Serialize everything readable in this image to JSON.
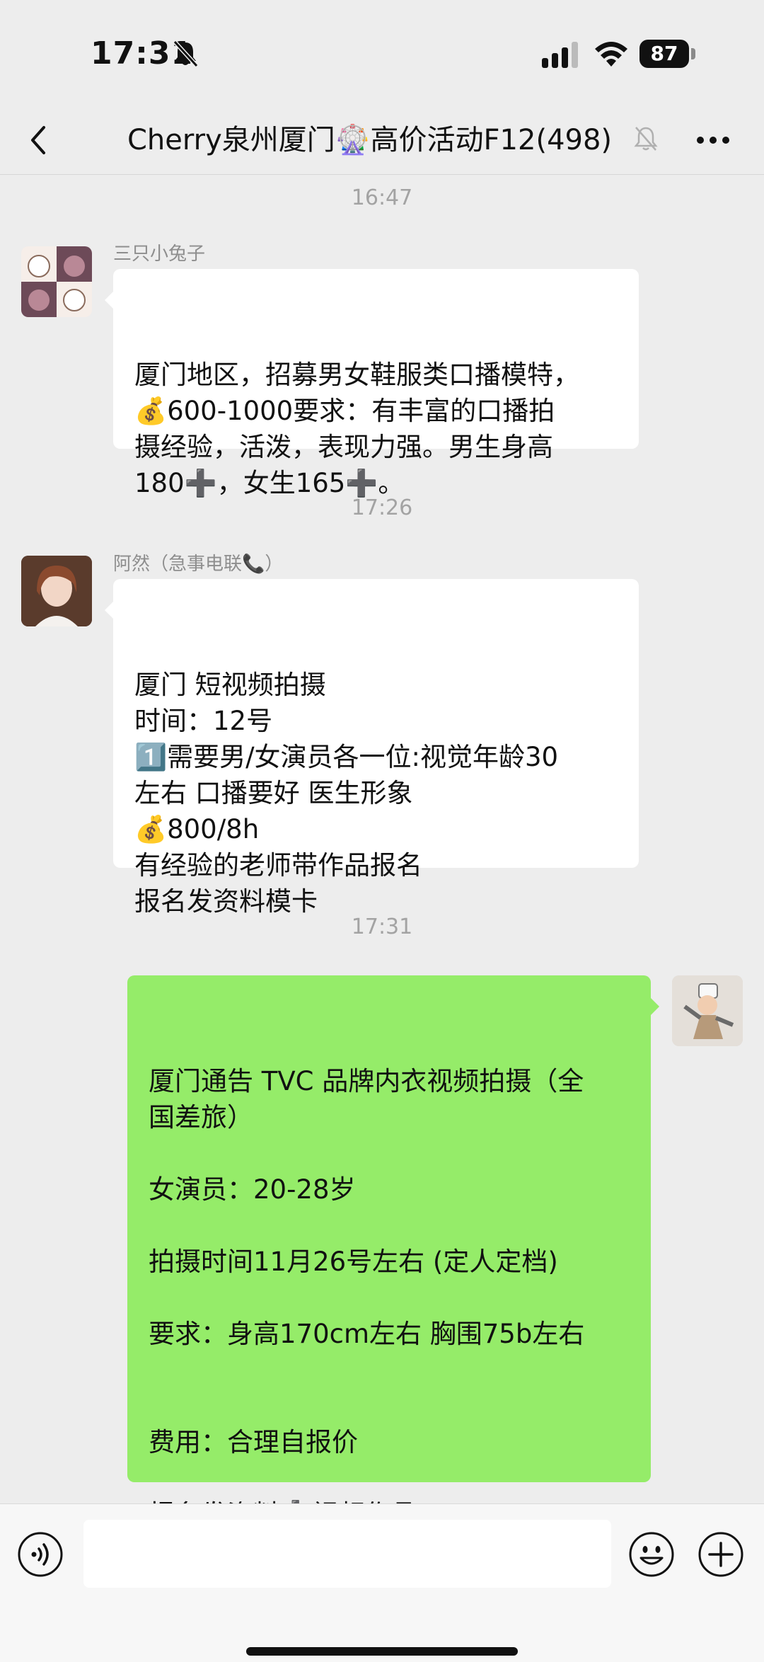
{
  "status": {
    "time": "17:31",
    "battery": "87"
  },
  "nav": {
    "title": "Cherry泉州厦门🎡高价活动F12(498)"
  },
  "messages": [
    {
      "timestamp": "16:47",
      "sender": "三只小兔子",
      "lines": [
        "厦门地区，招募男女鞋服类口播模特，",
        "💰600-1000要求：有丰富的口播拍",
        "摄经验，活泼，表现力强。男生身高",
        "180➕，女生165➕。"
      ]
    },
    {
      "timestamp": "17:26",
      "sender": "阿然（急事电联📞）",
      "lines": [
        "厦门 短视频拍摄",
        "时间：12号",
        "1️⃣需要男/女演员各一位:视觉年龄30",
        "左右 口播要好 医生形象",
        "💰800/8h",
        "有经验的老师带作品报名",
        "报名发资料模卡"
      ]
    },
    {
      "timestamp": "17:31",
      "sender": "",
      "lines": [
        "厦门通告 TVC 品牌内衣视频拍摄（全",
        "国差旅）",
        "",
        "女演员：20-28岁",
        "",
        "拍摄时间11月26号左右 (定人定档)",
        "",
        "要求：身高170cm左右 胸围75b左右",
        "",
        "",
        "费用：合理自报价",
        "",
        "报名发资料➕视频作品"
      ]
    }
  ],
  "colors": {
    "bubble_self": "#95ec69",
    "bubble_other": "#ffffff",
    "background": "#ededed"
  },
  "icons": [
    "back-icon",
    "mute-icon",
    "more-icon",
    "voice-icon",
    "emoji-icon",
    "plus-icon"
  ]
}
